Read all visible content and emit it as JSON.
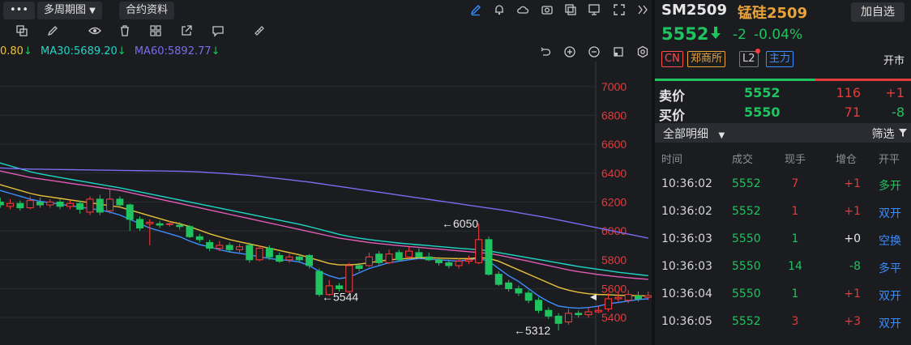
{
  "toolbar": {
    "more_label": "•••",
    "period_label": "多周期图",
    "contract_label": "合约资料"
  },
  "ma": {
    "ma_prev": "0.80",
    "ma30_label": "MA30:5689.20",
    "ma60_label": "MA60:5892.77",
    "color_prev": "#e8c23a",
    "color_ma30": "#1fd6c4",
    "color_ma60": "#7b6cf0"
  },
  "chart_data": {
    "type": "candlestick",
    "y_ticks": [
      7000,
      6800,
      6600,
      6400,
      6200,
      6000,
      5800,
      5600,
      5400
    ],
    "ylim": [
      5300,
      7150
    ],
    "annotations": [
      {
        "label": "←6050",
        "value": 6050
      },
      {
        "label": "←5544",
        "value": 5544
      },
      {
        "label": "←5312",
        "value": 5312
      }
    ],
    "current_price": 5552,
    "candles": [
      {
        "o": 6250,
        "c": 6220,
        "h": 6280,
        "l": 6200
      },
      {
        "o": 6200,
        "c": 6180,
        "h": 6230,
        "l": 6160
      },
      {
        "o": 6170,
        "c": 6190,
        "h": 6220,
        "l": 6150
      },
      {
        "o": 6190,
        "c": 6160,
        "h": 6210,
        "l": 6140
      },
      {
        "o": 6160,
        "c": 6210,
        "h": 6240,
        "l": 6150
      },
      {
        "o": 6200,
        "c": 6180,
        "h": 6230,
        "l": 6160
      },
      {
        "o": 6180,
        "c": 6200,
        "h": 6220,
        "l": 6160
      },
      {
        "o": 6200,
        "c": 6170,
        "h": 6220,
        "l": 6150
      },
      {
        "o": 6170,
        "c": 6190,
        "h": 6210,
        "l": 6150
      },
      {
        "o": 6190,
        "c": 6150,
        "h": 6210,
        "l": 6120
      },
      {
        "o": 6130,
        "c": 6220,
        "h": 6240,
        "l": 6110
      },
      {
        "o": 6220,
        "c": 6130,
        "h": 6250,
        "l": 6110
      },
      {
        "o": 6140,
        "c": 6220,
        "h": 6290,
        "l": 6120
      },
      {
        "o": 6220,
        "c": 6180,
        "h": 6240,
        "l": 6160
      },
      {
        "o": 6180,
        "c": 6080,
        "h": 6190,
        "l": 6000
      },
      {
        "o": 6080,
        "c": 6020,
        "h": 6100,
        "l": 6000
      },
      {
        "o": 6050,
        "c": 6060,
        "h": 6080,
        "l": 5900
      },
      {
        "o": 6050,
        "c": 6040,
        "h": 6070,
        "l": 6020
      },
      {
        "o": 6050,
        "c": 6050,
        "h": 6070,
        "l": 6030
      },
      {
        "o": 6040,
        "c": 6030,
        "h": 6060,
        "l": 6010
      },
      {
        "o": 6030,
        "c": 5960,
        "h": 6040,
        "l": 5950
      },
      {
        "o": 5960,
        "c": 5940,
        "h": 5980,
        "l": 5920
      },
      {
        "o": 5920,
        "c": 5880,
        "h": 5940,
        "l": 5860
      },
      {
        "o": 5880,
        "c": 5900,
        "h": 5930,
        "l": 5860
      },
      {
        "o": 5900,
        "c": 5870,
        "h": 5920,
        "l": 5850
      },
      {
        "o": 5870,
        "c": 5890,
        "h": 5910,
        "l": 5850
      },
      {
        "o": 5900,
        "c": 5800,
        "h": 5920,
        "l": 5780
      },
      {
        "o": 5800,
        "c": 5880,
        "h": 5900,
        "l": 5790
      },
      {
        "o": 5880,
        "c": 5820,
        "h": 5900,
        "l": 5800
      },
      {
        "o": 5830,
        "c": 5790,
        "h": 5850,
        "l": 5780
      },
      {
        "o": 5800,
        "c": 5820,
        "h": 5840,
        "l": 5780
      },
      {
        "o": 5820,
        "c": 5800,
        "h": 5840,
        "l": 5780
      },
      {
        "o": 5830,
        "c": 5760,
        "h": 5840,
        "l": 5740
      },
      {
        "o": 5720,
        "c": 5560,
        "h": 5740,
        "l": 5544
      },
      {
        "o": 5560,
        "c": 5620,
        "h": 5660,
        "l": 5550
      },
      {
        "o": 5620,
        "c": 5600,
        "h": 5640,
        "l": 5580
      },
      {
        "o": 5580,
        "c": 5760,
        "h": 5780,
        "l": 5570
      },
      {
        "o": 5760,
        "c": 5740,
        "h": 5780,
        "l": 5720
      },
      {
        "o": 5760,
        "c": 5820,
        "h": 5850,
        "l": 5750
      },
      {
        "o": 5840,
        "c": 5780,
        "h": 5860,
        "l": 5760
      },
      {
        "o": 5780,
        "c": 5840,
        "h": 5870,
        "l": 5770
      },
      {
        "o": 5850,
        "c": 5800,
        "h": 5870,
        "l": 5790
      },
      {
        "o": 5820,
        "c": 5860,
        "h": 5890,
        "l": 5810
      },
      {
        "o": 5850,
        "c": 5820,
        "h": 5880,
        "l": 5810
      },
      {
        "o": 5820,
        "c": 5800,
        "h": 5850,
        "l": 5790
      },
      {
        "o": 5800,
        "c": 5780,
        "h": 5820,
        "l": 5760
      },
      {
        "o": 5780,
        "c": 5760,
        "h": 5800,
        "l": 5740
      },
      {
        "o": 5760,
        "c": 5790,
        "h": 5810,
        "l": 5740
      },
      {
        "o": 5790,
        "c": 5800,
        "h": 5830,
        "l": 5770
      },
      {
        "o": 5780,
        "c": 5940,
        "h": 6050,
        "l": 5770
      },
      {
        "o": 5940,
        "c": 5700,
        "h": 5960,
        "l": 5690
      },
      {
        "o": 5700,
        "c": 5630,
        "h": 5720,
        "l": 5620
      },
      {
        "o": 5640,
        "c": 5600,
        "h": 5660,
        "l": 5580
      },
      {
        "o": 5600,
        "c": 5570,
        "h": 5620,
        "l": 5550
      },
      {
        "o": 5570,
        "c": 5520,
        "h": 5590,
        "l": 5500
      },
      {
        "o": 5520,
        "c": 5450,
        "h": 5540,
        "l": 5430
      },
      {
        "o": 5450,
        "c": 5410,
        "h": 5470,
        "l": 5390
      },
      {
        "o": 5410,
        "c": 5360,
        "h": 5430,
        "l": 5312
      },
      {
        "o": 5370,
        "c": 5430,
        "h": 5460,
        "l": 5350
      },
      {
        "o": 5430,
        "c": 5420,
        "h": 5450,
        "l": 5400
      },
      {
        "o": 5420,
        "c": 5440,
        "h": 5470,
        "l": 5400
      },
      {
        "o": 5440,
        "c": 5450,
        "h": 5480,
        "l": 5430
      },
      {
        "o": 5460,
        "c": 5530,
        "h": 5570,
        "l": 5440
      },
      {
        "o": 5530,
        "c": 5540,
        "h": 5580,
        "l": 5510
      },
      {
        "o": 5520,
        "c": 5560,
        "h": 5590,
        "l": 5500
      },
      {
        "o": 5550,
        "c": 5530,
        "h": 5580,
        "l": 5510
      },
      {
        "o": 5540,
        "c": 5552,
        "h": 5580,
        "l": 5520
      }
    ],
    "ma_lines": [
      {
        "name": "ma-short-blue",
        "color": "#3d8fff",
        "values": [
          6310,
          6280,
          6260,
          6240,
          6220,
          6205,
          6195,
          6185,
          6175,
          6165,
          6155,
          6145,
          6130,
          6110,
          6080,
          6050,
          6020,
          6000,
          5980,
          5960,
          5930,
          5905,
          5890,
          5870,
          5855,
          5845,
          5835,
          5820,
          5810,
          5800,
          5795,
          5785,
          5760,
          5720,
          5690,
          5670,
          5680,
          5710,
          5740,
          5760,
          5780,
          5790,
          5800,
          5810,
          5805,
          5800,
          5795,
          5790,
          5800,
          5810,
          5790,
          5740,
          5690,
          5650,
          5600,
          5550,
          5510,
          5480,
          5470,
          5465,
          5470,
          5480,
          5495,
          5505,
          5515,
          5525,
          5530
        ]
      },
      {
        "name": "ma-yellow",
        "color": "#e8c23a",
        "values": [
          6340,
          6320,
          6300,
          6280,
          6260,
          6245,
          6235,
          6225,
          6215,
          6205,
          6195,
          6185,
          6175,
          6165,
          6145,
          6125,
          6105,
          6085,
          6065,
          6050,
          6030,
          6005,
          5980,
          5960,
          5940,
          5925,
          5910,
          5895,
          5880,
          5865,
          5850,
          5835,
          5815,
          5795,
          5775,
          5765,
          5765,
          5770,
          5780,
          5790,
          5800,
          5805,
          5810,
          5815,
          5815,
          5812,
          5810,
          5808,
          5808,
          5815,
          5810,
          5790,
          5760,
          5730,
          5700,
          5670,
          5640,
          5610,
          5590,
          5575,
          5565,
          5560,
          5558,
          5555,
          5553,
          5552,
          5550
        ]
      },
      {
        "name": "ma-pink",
        "color": "#e05bb5",
        "values": [
          6430,
          6415,
          6400,
          6385,
          6370,
          6360,
          6350,
          6340,
          6330,
          6320,
          6310,
          6300,
          6290,
          6280,
          6265,
          6250,
          6235,
          6220,
          6205,
          6190,
          6175,
          6160,
          6145,
          6130,
          6115,
          6100,
          6085,
          6070,
          6055,
          6040,
          6025,
          6010,
          5995,
          5980,
          5965,
          5950,
          5940,
          5930,
          5920,
          5912,
          5905,
          5898,
          5892,
          5886,
          5880,
          5874,
          5868,
          5862,
          5856,
          5850,
          5844,
          5832,
          5818,
          5804,
          5790,
          5775,
          5760,
          5745,
          5730,
          5718,
          5708,
          5698,
          5690,
          5682,
          5676,
          5670,
          5665
        ]
      },
      {
        "name": "ma30-cyan",
        "color": "#1fd6c4",
        "values": [
          6500,
          6470,
          6450,
          6430,
          6410,
          6395,
          6382,
          6370,
          6358,
          6346,
          6334,
          6322,
          6310,
          6298,
          6284,
          6270,
          6256,
          6242,
          6228,
          6214,
          6200,
          6186,
          6172,
          6158,
          6144,
          6130,
          6116,
          6102,
          6088,
          6074,
          6060,
          6046,
          6030,
          6012,
          5994,
          5976,
          5962,
          5950,
          5940,
          5932,
          5924,
          5916,
          5910,
          5904,
          5898,
          5892,
          5886,
          5880,
          5875,
          5870,
          5862,
          5850,
          5838,
          5826,
          5814,
          5802,
          5790,
          5778,
          5766,
          5754,
          5744,
          5734,
          5724,
          5714,
          5706,
          5698,
          5690
        ]
      },
      {
        "name": "ma60-purple",
        "color": "#7b6cf0",
        "values": [
          6440,
          6436,
          6432,
          6430,
          6428,
          6427,
          6426,
          6425,
          6424,
          6423,
          6422,
          6421,
          6420,
          6419,
          6418,
          6417,
          6416,
          6415,
          6414,
          6413,
          6411,
          6408,
          6404,
          6400,
          6395,
          6390,
          6385,
          6378,
          6370,
          6362,
          6354,
          6346,
          6338,
          6328,
          6318,
          6308,
          6298,
          6288,
          6278,
          6268,
          6258,
          6248,
          6238,
          6228,
          6218,
          6208,
          6198,
          6188,
          6178,
          6168,
          6158,
          6148,
          6138,
          6126,
          6114,
          6102,
          6090,
          6076,
          6062,
          6048,
          6034,
          6020,
          6006,
          5992,
          5978,
          5964,
          5950
        ]
      }
    ]
  },
  "quote": {
    "code": "SM2509",
    "name": "锰硅2509",
    "add_label": "加自选",
    "price": "5552",
    "change": "-2",
    "pct": "-0.04%",
    "tags": [
      "CN",
      "郑商所",
      "L2",
      "主力"
    ],
    "status": "开市",
    "ask_label": "卖价",
    "ask_price": "5552",
    "ask_vol": "116",
    "ask_delta": "+1",
    "bid_label": "买价",
    "bid_price": "5550",
    "bid_vol": "71",
    "bid_delta": "-8",
    "filter_left": "全部明细",
    "filter_right": "筛选",
    "headers": [
      "时间",
      "成交",
      "现手",
      "增仓",
      "开平"
    ],
    "ticks": [
      {
        "time": "10:36:02",
        "price": "5552",
        "vol": "7",
        "oi": "+1",
        "type": "多开",
        "pcolor": "#1fc35f",
        "vcolor": "#e23b3b",
        "oicolor": "#e23b3b",
        "tcolor": "#1fc35f"
      },
      {
        "time": "10:36:02",
        "price": "5552",
        "vol": "1",
        "oi": "+1",
        "type": "双开",
        "pcolor": "#1fc35f",
        "vcolor": "#e23b3b",
        "oicolor": "#e23b3b",
        "tcolor": "#3b8cff"
      },
      {
        "time": "10:36:03",
        "price": "5550",
        "vol": "1",
        "oi": "+0",
        "type": "空换",
        "pcolor": "#1fc35f",
        "vcolor": "#1fc35f",
        "oicolor": "#e6e6e6",
        "tcolor": "#3b8cff"
      },
      {
        "time": "10:36:03",
        "price": "5550",
        "vol": "14",
        "oi": "-8",
        "type": "多平",
        "pcolor": "#1fc35f",
        "vcolor": "#1fc35f",
        "oicolor": "#1fc35f",
        "tcolor": "#3b8cff"
      },
      {
        "time": "10:36:04",
        "price": "5550",
        "vol": "1",
        "oi": "+1",
        "type": "双开",
        "pcolor": "#1fc35f",
        "vcolor": "#1fc35f",
        "oicolor": "#e23b3b",
        "tcolor": "#3b8cff"
      },
      {
        "time": "10:36:05",
        "price": "5552",
        "vol": "3",
        "oi": "+3",
        "type": "双开",
        "pcolor": "#1fc35f",
        "vcolor": "#e23b3b",
        "oicolor": "#e23b3b",
        "tcolor": "#3b8cff"
      }
    ]
  }
}
